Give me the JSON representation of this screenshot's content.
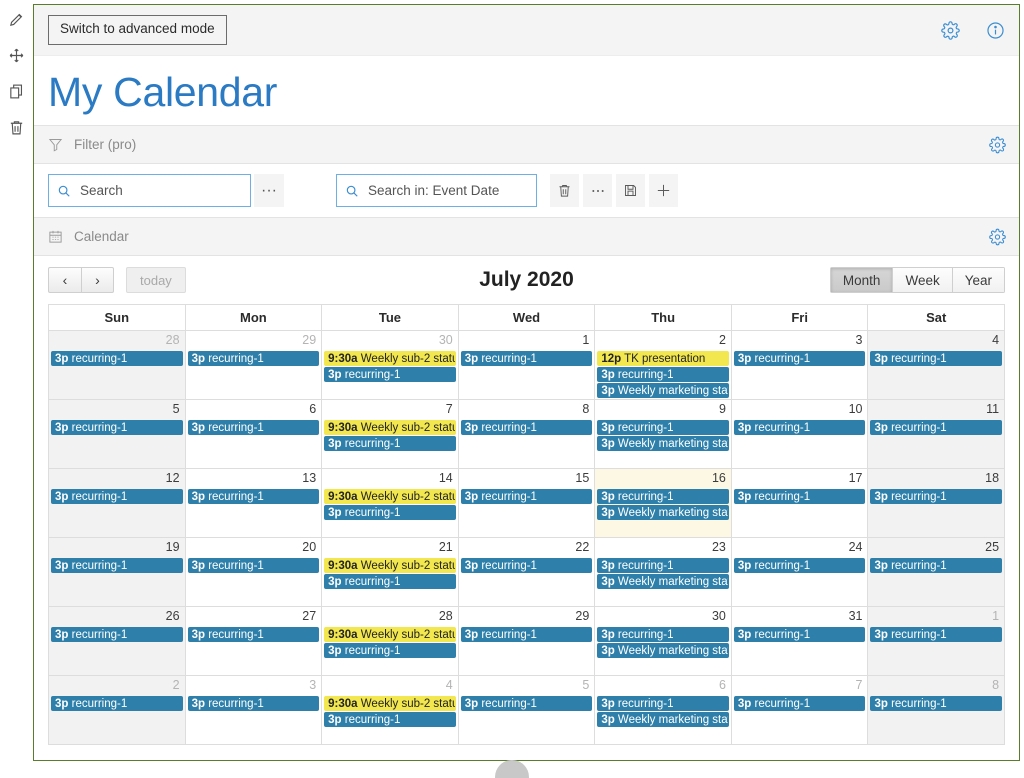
{
  "rail": {
    "items": [
      {
        "icon": "pencil-icon",
        "name": "edit"
      },
      {
        "icon": "move-icon",
        "name": "move"
      },
      {
        "icon": "copy-icon",
        "name": "copy"
      },
      {
        "icon": "trash-icon",
        "name": "delete"
      }
    ]
  },
  "topbar": {
    "advanced_mode_label": "Switch to advanced mode",
    "settings_icon": "gear-icon",
    "info_icon": "info-icon"
  },
  "header": {
    "title": "My Calendar"
  },
  "filter_strip": {
    "icon": "funnel-icon",
    "label": "Filter (pro)",
    "gear_icon": "gear-icon"
  },
  "search": {
    "main": {
      "icon": "search-icon",
      "placeholder": "Search",
      "value": ""
    },
    "main_more_label": "···",
    "scope": {
      "icon": "search-icon",
      "placeholder": "Search in: Event Date",
      "value": ""
    },
    "actions": [
      {
        "name": "delete-search-button",
        "icon": "trash-icon"
      },
      {
        "name": "more-options-button",
        "icon": "ellipsis-icon"
      },
      {
        "name": "save-search-button",
        "icon": "save-icon"
      },
      {
        "name": "add-search-button",
        "icon": "plus-icon"
      }
    ]
  },
  "calendar_strip": {
    "icon": "calendar-icon",
    "label": "Calendar",
    "gear_icon": "gear-icon"
  },
  "calendar": {
    "prev_label": "‹",
    "next_label": "›",
    "today_label": "today",
    "month_label": "July 2020",
    "views": [
      {
        "label": "Month",
        "active": true
      },
      {
        "label": "Week",
        "active": false
      },
      {
        "label": "Year",
        "active": false
      }
    ],
    "day_headers": [
      "Sun",
      "Mon",
      "Tue",
      "Wed",
      "Thu",
      "Fri",
      "Sat"
    ],
    "colors": {
      "event_blue": "#2e80ab",
      "event_yellow": "#f2e74e",
      "today_bg": "#fcf8e3",
      "weekend_bg": "#f2f2f2",
      "accent_blue": "#2a7ac4",
      "frame_green": "#5a7d2a"
    },
    "weeks": [
      [
        {
          "day": "28",
          "other": true,
          "weekend": true,
          "today": false,
          "events": [
            {
              "time": "3p",
              "title": "recurring-1",
              "color": "blue"
            }
          ]
        },
        {
          "day": "29",
          "other": true,
          "weekend": false,
          "today": false,
          "events": [
            {
              "time": "3p",
              "title": "recurring-1",
              "color": "blue"
            }
          ]
        },
        {
          "day": "30",
          "other": true,
          "weekend": false,
          "today": false,
          "events": [
            {
              "time": "9:30a",
              "title": "Weekly sub-2 statu",
              "color": "yellow"
            },
            {
              "time": "3p",
              "title": "recurring-1",
              "color": "blue"
            }
          ]
        },
        {
          "day": "1",
          "other": false,
          "weekend": false,
          "today": false,
          "events": [
            {
              "time": "3p",
              "title": "recurring-1",
              "color": "blue"
            }
          ]
        },
        {
          "day": "2",
          "other": false,
          "weekend": false,
          "today": false,
          "events": [
            {
              "time": "12p",
              "title": "TK presentation",
              "color": "yellow"
            },
            {
              "time": "3p",
              "title": "recurring-1",
              "color": "blue"
            },
            {
              "time": "3p",
              "title": "Weekly marketing stat",
              "color": "blue"
            }
          ]
        },
        {
          "day": "3",
          "other": false,
          "weekend": false,
          "today": false,
          "events": [
            {
              "time": "3p",
              "title": "recurring-1",
              "color": "blue"
            }
          ]
        },
        {
          "day": "4",
          "other": false,
          "weekend": true,
          "today": false,
          "events": [
            {
              "time": "3p",
              "title": "recurring-1",
              "color": "blue"
            }
          ]
        }
      ],
      [
        {
          "day": "5",
          "other": false,
          "weekend": true,
          "today": false,
          "events": [
            {
              "time": "3p",
              "title": "recurring-1",
              "color": "blue"
            }
          ]
        },
        {
          "day": "6",
          "other": false,
          "weekend": false,
          "today": false,
          "events": [
            {
              "time": "3p",
              "title": "recurring-1",
              "color": "blue"
            }
          ]
        },
        {
          "day": "7",
          "other": false,
          "weekend": false,
          "today": false,
          "events": [
            {
              "time": "9:30a",
              "title": "Weekly sub-2 statu",
              "color": "yellow"
            },
            {
              "time": "3p",
              "title": "recurring-1",
              "color": "blue"
            }
          ]
        },
        {
          "day": "8",
          "other": false,
          "weekend": false,
          "today": false,
          "events": [
            {
              "time": "3p",
              "title": "recurring-1",
              "color": "blue"
            }
          ]
        },
        {
          "day": "9",
          "other": false,
          "weekend": false,
          "today": false,
          "events": [
            {
              "time": "3p",
              "title": "recurring-1",
              "color": "blue"
            },
            {
              "time": "3p",
              "title": "Weekly marketing stat",
              "color": "blue"
            }
          ]
        },
        {
          "day": "10",
          "other": false,
          "weekend": false,
          "today": false,
          "events": [
            {
              "time": "3p",
              "title": "recurring-1",
              "color": "blue"
            }
          ]
        },
        {
          "day": "11",
          "other": false,
          "weekend": true,
          "today": false,
          "events": [
            {
              "time": "3p",
              "title": "recurring-1",
              "color": "blue"
            }
          ]
        }
      ],
      [
        {
          "day": "12",
          "other": false,
          "weekend": true,
          "today": false,
          "events": [
            {
              "time": "3p",
              "title": "recurring-1",
              "color": "blue"
            }
          ]
        },
        {
          "day": "13",
          "other": false,
          "weekend": false,
          "today": false,
          "events": [
            {
              "time": "3p",
              "title": "recurring-1",
              "color": "blue"
            }
          ]
        },
        {
          "day": "14",
          "other": false,
          "weekend": false,
          "today": false,
          "events": [
            {
              "time": "9:30a",
              "title": "Weekly sub-2 statu",
              "color": "yellow"
            },
            {
              "time": "3p",
              "title": "recurring-1",
              "color": "blue"
            }
          ]
        },
        {
          "day": "15",
          "other": false,
          "weekend": false,
          "today": false,
          "events": [
            {
              "time": "3p",
              "title": "recurring-1",
              "color": "blue"
            }
          ]
        },
        {
          "day": "16",
          "other": false,
          "weekend": false,
          "today": true,
          "events": [
            {
              "time": "3p",
              "title": "recurring-1",
              "color": "blue"
            },
            {
              "time": "3p",
              "title": "Weekly marketing stat",
              "color": "blue"
            }
          ]
        },
        {
          "day": "17",
          "other": false,
          "weekend": false,
          "today": false,
          "events": [
            {
              "time": "3p",
              "title": "recurring-1",
              "color": "blue"
            }
          ]
        },
        {
          "day": "18",
          "other": false,
          "weekend": true,
          "today": false,
          "events": [
            {
              "time": "3p",
              "title": "recurring-1",
              "color": "blue"
            }
          ]
        }
      ],
      [
        {
          "day": "19",
          "other": false,
          "weekend": true,
          "today": false,
          "events": [
            {
              "time": "3p",
              "title": "recurring-1",
              "color": "blue"
            }
          ]
        },
        {
          "day": "20",
          "other": false,
          "weekend": false,
          "today": false,
          "events": [
            {
              "time": "3p",
              "title": "recurring-1",
              "color": "blue"
            }
          ]
        },
        {
          "day": "21",
          "other": false,
          "weekend": false,
          "today": false,
          "events": [
            {
              "time": "9:30a",
              "title": "Weekly sub-2 statu",
              "color": "yellow"
            },
            {
              "time": "3p",
              "title": "recurring-1",
              "color": "blue"
            }
          ]
        },
        {
          "day": "22",
          "other": false,
          "weekend": false,
          "today": false,
          "events": [
            {
              "time": "3p",
              "title": "recurring-1",
              "color": "blue"
            }
          ]
        },
        {
          "day": "23",
          "other": false,
          "weekend": false,
          "today": false,
          "events": [
            {
              "time": "3p",
              "title": "recurring-1",
              "color": "blue"
            },
            {
              "time": "3p",
              "title": "Weekly marketing stat",
              "color": "blue"
            }
          ]
        },
        {
          "day": "24",
          "other": false,
          "weekend": false,
          "today": false,
          "events": [
            {
              "time": "3p",
              "title": "recurring-1",
              "color": "blue"
            }
          ]
        },
        {
          "day": "25",
          "other": false,
          "weekend": true,
          "today": false,
          "events": [
            {
              "time": "3p",
              "title": "recurring-1",
              "color": "blue"
            }
          ]
        }
      ],
      [
        {
          "day": "26",
          "other": false,
          "weekend": true,
          "today": false,
          "events": [
            {
              "time": "3p",
              "title": "recurring-1",
              "color": "blue"
            }
          ]
        },
        {
          "day": "27",
          "other": false,
          "weekend": false,
          "today": false,
          "events": [
            {
              "time": "3p",
              "title": "recurring-1",
              "color": "blue"
            }
          ]
        },
        {
          "day": "28",
          "other": false,
          "weekend": false,
          "today": false,
          "events": [
            {
              "time": "9:30a",
              "title": "Weekly sub-2 statu",
              "color": "yellow"
            },
            {
              "time": "3p",
              "title": "recurring-1",
              "color": "blue"
            }
          ]
        },
        {
          "day": "29",
          "other": false,
          "weekend": false,
          "today": false,
          "events": [
            {
              "time": "3p",
              "title": "recurring-1",
              "color": "blue"
            }
          ]
        },
        {
          "day": "30",
          "other": false,
          "weekend": false,
          "today": false,
          "events": [
            {
              "time": "3p",
              "title": "recurring-1",
              "color": "blue"
            },
            {
              "time": "3p",
              "title": "Weekly marketing stat",
              "color": "blue"
            }
          ]
        },
        {
          "day": "31",
          "other": false,
          "weekend": false,
          "today": false,
          "events": [
            {
              "time": "3p",
              "title": "recurring-1",
              "color": "blue"
            }
          ]
        },
        {
          "day": "1",
          "other": true,
          "weekend": true,
          "today": false,
          "events": [
            {
              "time": "3p",
              "title": "recurring-1",
              "color": "blue"
            }
          ]
        }
      ],
      [
        {
          "day": "2",
          "other": true,
          "weekend": true,
          "today": false,
          "events": [
            {
              "time": "3p",
              "title": "recurring-1",
              "color": "blue"
            }
          ]
        },
        {
          "day": "3",
          "other": true,
          "weekend": false,
          "today": false,
          "events": [
            {
              "time": "3p",
              "title": "recurring-1",
              "color": "blue"
            }
          ]
        },
        {
          "day": "4",
          "other": true,
          "weekend": false,
          "today": false,
          "events": [
            {
              "time": "9:30a",
              "title": "Weekly sub-2 statu",
              "color": "yellow"
            },
            {
              "time": "3p",
              "title": "recurring-1",
              "color": "blue"
            }
          ]
        },
        {
          "day": "5",
          "other": true,
          "weekend": false,
          "today": false,
          "events": [
            {
              "time": "3p",
              "title": "recurring-1",
              "color": "blue"
            }
          ]
        },
        {
          "day": "6",
          "other": true,
          "weekend": false,
          "today": false,
          "events": [
            {
              "time": "3p",
              "title": "recurring-1",
              "color": "blue"
            },
            {
              "time": "3p",
              "title": "Weekly marketing stat",
              "color": "blue"
            }
          ]
        },
        {
          "day": "7",
          "other": true,
          "weekend": false,
          "today": false,
          "events": [
            {
              "time": "3p",
              "title": "recurring-1",
              "color": "blue"
            }
          ]
        },
        {
          "day": "8",
          "other": true,
          "weekend": true,
          "today": false,
          "events": [
            {
              "time": "3p",
              "title": "recurring-1",
              "color": "blue"
            }
          ]
        }
      ]
    ]
  }
}
